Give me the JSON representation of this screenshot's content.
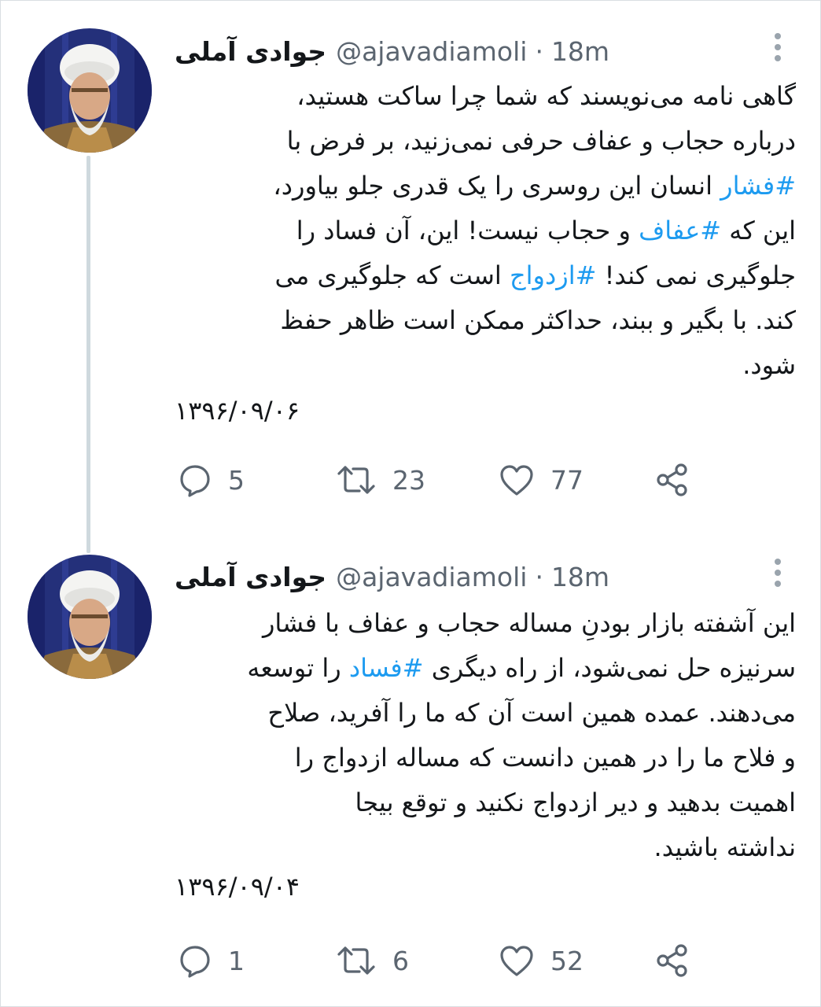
{
  "colors": {
    "link": "#1d9bf0",
    "text": "#14171a",
    "secondary": "#5b6570",
    "thread_line": "#cfd9de"
  },
  "tweets": [
    {
      "display_name": "جوادی آملی",
      "handle": "@ajavadiamoli",
      "separator": "·",
      "time": "18m",
      "text_parts": [
        "گاهی نامه می‌نویسند که شما چرا ساکت هستید،\nدرباره حجاب و عفاف حرفی نمی‌زنید، بر فرض با\n",
        "#فشار",
        " انسان این روسری را یک قدری جلو بیاورد،\nاین که ",
        "#عفاف",
        " و حجاب نیست! این، آن فساد را\nجلوگیری نمی کند! ",
        "#ازدواج",
        " است که جلوگیری می\nکند. با بگیر و ببند، حداکثر ممکن است ظاهر حفظ\nشود."
      ],
      "date": "۱۳۹۶/۰۹/۰۶",
      "replies": "5",
      "retweets": "23",
      "likes": "77"
    },
    {
      "display_name": "جوادی آملی",
      "handle": "@ajavadiamoli",
      "separator": "·",
      "time": "18m",
      "text_parts": [
        "این آشفته بازار بودنِ مساله حجاب و عفاف با فشار\nسرنیزه حل نمی‌شود، از راه دیگری ",
        "#فساد",
        " را توسعه\nمی‌دهند. عمده همین است آن که ما را آفرید، صلاح\nو فلاح ما را در همین دانست که مساله ازدواج را\nاهمیت بدهید و دیر ازدواج نکنید و توقع بیجا\nنداشته باشید."
      ],
      "date": "۱۳۹۶/۰۹/۰۴",
      "replies": "1",
      "retweets": "6",
      "likes": "52"
    }
  ],
  "icons": {
    "reply": "reply-icon",
    "retweet": "retweet-icon",
    "like": "heart-icon",
    "share": "share-icon",
    "more": "more-vertical-icon"
  }
}
